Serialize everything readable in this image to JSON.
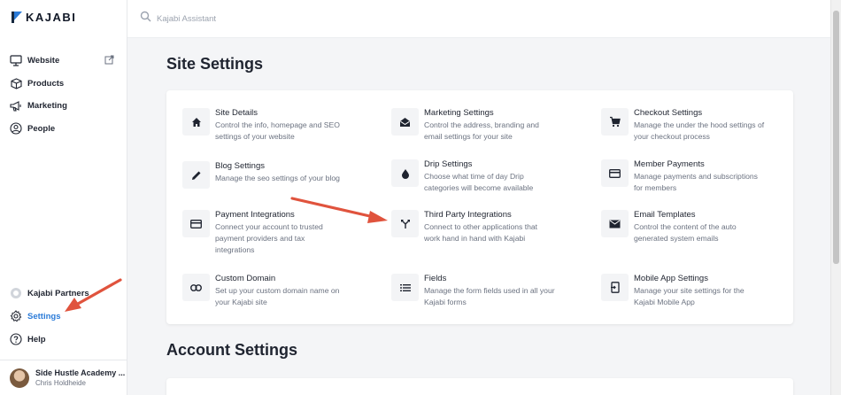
{
  "brand": {
    "logo_text": "KAJABI"
  },
  "sidebar": {
    "items": [
      {
        "label": "Website",
        "icon": "monitor-icon"
      },
      {
        "label": "Products",
        "icon": "box-icon"
      },
      {
        "label": "Marketing",
        "icon": "megaphone-icon"
      },
      {
        "label": "People",
        "icon": "user-circle-icon"
      }
    ],
    "bottom_items": [
      {
        "label": "Kajabi Partners",
        "icon": "partners-icon"
      },
      {
        "label": "Settings",
        "icon": "gear-icon",
        "active": true
      },
      {
        "label": "Help",
        "icon": "help-icon"
      }
    ],
    "user": {
      "name": "Side Hustle Academy ...",
      "subtitle": "Chris Holdheide"
    }
  },
  "search": {
    "placeholder": "Kajabi Assistant"
  },
  "site_settings": {
    "title": "Site Settings",
    "tiles": [
      {
        "title": "Site Details",
        "desc_lines": [
          "Control the info, homepage and SEO",
          "settings of your website"
        ],
        "icon": "home-icon"
      },
      {
        "title": "Marketing Settings",
        "desc_lines": [
          "Control the address, branding and",
          "email settings for your site"
        ],
        "icon": "envelope-open-icon"
      },
      {
        "title": "Checkout Settings",
        "desc_lines": [
          "Manage the under the hood settings of",
          "your checkout process"
        ],
        "icon": "cart-icon"
      },
      {
        "title": "Blog Settings",
        "desc_lines": [
          "Manage the seo settings of your blog"
        ],
        "icon": "pencil-icon"
      },
      {
        "title": "Drip Settings",
        "desc_lines": [
          "Choose what time of day Drip",
          "categories will become available"
        ],
        "icon": "drop-icon"
      },
      {
        "title": "Member Payments",
        "desc_lines": [
          "Manage payments and subscriptions",
          "for members"
        ],
        "icon": "credit-card-icon"
      },
      {
        "title": "Payment Integrations",
        "desc_lines": [
          "Connect your account to trusted",
          "payment providers and tax",
          "integrations"
        ],
        "icon": "credit-card-icon"
      },
      {
        "title": "Third Party Integrations",
        "desc_lines": [
          "Connect to other applications that",
          "work hand in hand with Kajabi"
        ],
        "icon": "merge-icon"
      },
      {
        "title": "Email Templates",
        "desc_lines": [
          "Control the content of the auto",
          "generated system emails"
        ],
        "icon": "envelope-icon"
      },
      {
        "title": "Custom Domain",
        "desc_lines": [
          "Set up your custom domain name on",
          "your Kajabi site"
        ],
        "icon": "link-icon"
      },
      {
        "title": "Fields",
        "desc_lines": [
          "Manage the form fields used in all your",
          "Kajabi forms"
        ],
        "icon": "list-icon"
      },
      {
        "title": "Mobile App Settings",
        "desc_lines": [
          "Manage your site settings for the",
          "Kajabi Mobile App"
        ],
        "icon": "mobile-icon"
      }
    ]
  },
  "account_settings": {
    "title": "Account Settings"
  },
  "colors": {
    "accent": "#2b7bd8",
    "annotation_arrow": "#e0533d"
  }
}
